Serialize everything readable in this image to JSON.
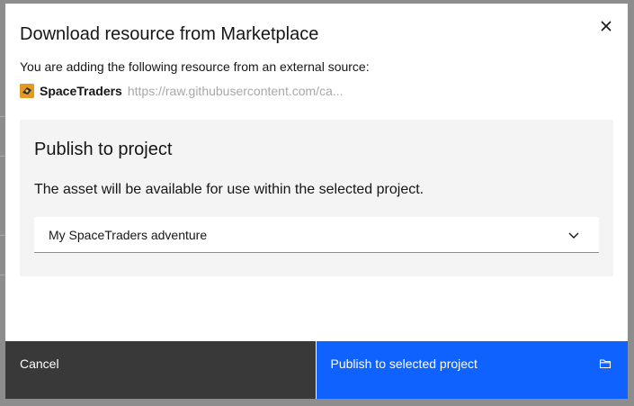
{
  "dialog": {
    "title": "Download resource from Marketplace",
    "subtitle": "You are adding the following resource from an external source:",
    "resource": {
      "name": "SpaceTraders",
      "url": "https://raw.githubusercontent.com/ca...",
      "icon": "spacetraders-logo-icon"
    },
    "close_icon": "close-icon"
  },
  "publish_panel": {
    "title": "Publish to project",
    "description": "The asset will be available for use within the selected project.",
    "project_select": {
      "selected": "My SpaceTraders adventure",
      "icon": "chevron-down-icon"
    }
  },
  "footer": {
    "cancel_label": "Cancel",
    "primary_label": "Publish to selected project",
    "primary_icon": "folder-icon"
  },
  "colors": {
    "primary": "#0f62fe",
    "secondary": "#393939",
    "panel": "#f4f4f4",
    "overlay": "#8d8d8d"
  }
}
